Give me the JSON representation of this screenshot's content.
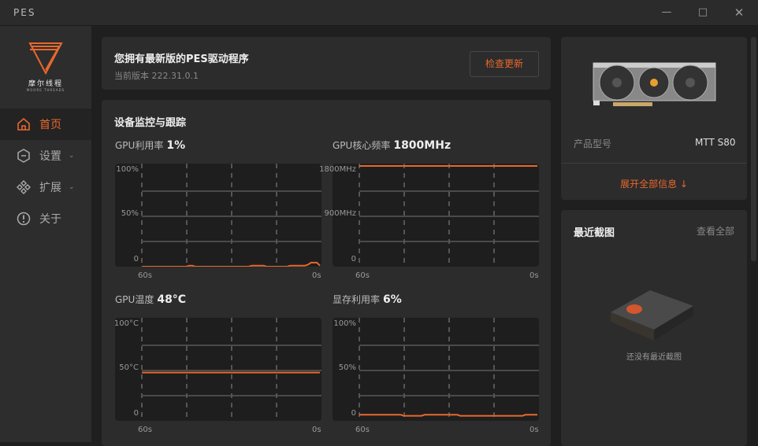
{
  "app": {
    "title": "PES"
  },
  "window_controls": [
    "minimize",
    "maximize",
    "close"
  ],
  "sidebar": {
    "logo_text": "摩尔线程",
    "logo_sub": "MOORE THREADS",
    "items": [
      {
        "label": "首页",
        "icon": "home-icon",
        "active": true
      },
      {
        "label": "设置",
        "icon": "settings-icon",
        "expandable": true
      },
      {
        "label": "扩展",
        "icon": "extensions-icon",
        "expandable": true
      },
      {
        "label": "关于",
        "icon": "info-icon"
      }
    ]
  },
  "update": {
    "title": "您拥有最新版的PES驱动程序",
    "version": "当前版本 222.31.0.1",
    "button": "检查更新"
  },
  "monitor": {
    "title": "设备监控与跟踪"
  },
  "accent": "#e8682d",
  "chart_data": [
    {
      "type": "line",
      "label": "GPU利用率",
      "value": "1%",
      "ytick_labels": [
        "100%",
        "50%",
        "0"
      ],
      "ylim": [
        0,
        100
      ],
      "xtick_labels": [
        "60s",
        "0s"
      ],
      "xlim": [
        60,
        0
      ],
      "values": [
        0,
        0,
        0,
        0,
        0,
        0,
        0,
        0,
        0,
        0,
        0,
        0,
        0,
        0,
        0,
        0,
        1,
        1,
        0,
        0,
        0,
        0,
        0,
        0,
        0,
        0,
        0,
        0,
        0,
        0,
        0,
        0,
        0,
        0,
        0,
        0,
        0,
        1,
        1,
        1,
        1,
        1,
        0,
        0,
        0,
        0,
        0,
        0,
        0,
        0,
        1,
        1,
        1,
        1,
        1,
        1,
        2,
        4,
        4,
        4,
        1
      ]
    },
    {
      "type": "line",
      "label": "GPU核心频率",
      "value": "1800MHz",
      "ytick_labels": [
        "1800MHz",
        "900MHz",
        "0"
      ],
      "ylim": [
        0,
        1800
      ],
      "xtick_labels": [
        "60s",
        "0s"
      ],
      "xlim": [
        60,
        0
      ],
      "values": [
        1800,
        1800,
        1800,
        1800,
        1800,
        1800,
        1800,
        1800,
        1800,
        1800,
        1800,
        1800,
        1800,
        1800,
        1800,
        1800,
        1800,
        1800,
        1800,
        1800,
        1800,
        1800,
        1800,
        1800,
        1800,
        1800,
        1800,
        1800,
        1800,
        1800,
        1800,
        1800,
        1800,
        1800,
        1800,
        1800,
        1800,
        1800,
        1800,
        1800,
        1800,
        1800,
        1800,
        1800,
        1800,
        1800,
        1800,
        1800,
        1800,
        1800,
        1800,
        1800,
        1800,
        1800,
        1800,
        1800,
        1800,
        1800,
        1800,
        1800,
        1800
      ]
    },
    {
      "type": "line",
      "label": "GPU温度",
      "value": "48°C",
      "ytick_labels": [
        "100°C",
        "50°C",
        "0"
      ],
      "ylim": [
        0,
        100
      ],
      "xtick_labels": [
        "60s",
        "0s"
      ],
      "xlim": [
        60,
        0
      ],
      "values": [
        48,
        48,
        48,
        48,
        48,
        48,
        48,
        48,
        48,
        48,
        48,
        48,
        48,
        48,
        48,
        48,
        48,
        48,
        48,
        48,
        48,
        48,
        48,
        48,
        48,
        48,
        48,
        48,
        48,
        48,
        48,
        48,
        48,
        48,
        48,
        48,
        48,
        48,
        48,
        48,
        48,
        48,
        48,
        48,
        48,
        48,
        48,
        48,
        48,
        48,
        48,
        48,
        48,
        48,
        48,
        48,
        48,
        48,
        48,
        48,
        48
      ]
    },
    {
      "type": "line",
      "label": "显存利用率",
      "value": "6%",
      "ytick_labels": [
        "100%",
        "50%",
        "0"
      ],
      "ylim": [
        0,
        100
      ],
      "xtick_labels": [
        "60s",
        "0s"
      ],
      "xlim": [
        60,
        0
      ],
      "values": [
        6,
        6,
        6,
        6,
        6,
        6,
        6,
        6,
        6,
        6,
        6,
        6,
        6,
        6,
        6,
        5,
        5,
        5,
        5,
        5,
        5,
        5,
        6,
        6,
        6,
        6,
        6,
        6,
        6,
        6,
        6,
        6,
        6,
        6,
        5,
        5,
        5,
        5,
        5,
        5,
        5,
        5,
        5,
        5,
        5,
        5,
        5,
        5,
        5,
        5,
        5,
        5,
        5,
        5,
        5,
        5,
        6,
        6,
        6,
        6,
        6
      ]
    }
  ],
  "device": {
    "model_label": "产品型号",
    "model_value": "MTT S80",
    "expand": "展开全部信息 ↓"
  },
  "screenshots": {
    "title": "最近截图",
    "view_all": "查看全部",
    "empty": "还没有最近截图"
  }
}
